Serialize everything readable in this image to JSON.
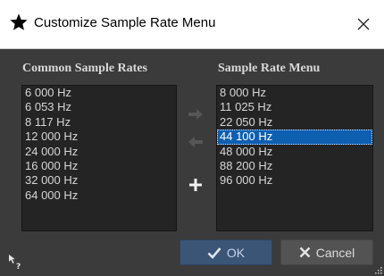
{
  "window": {
    "title": "Customize Sample Rate Menu",
    "title_icon": "star-icon",
    "close_icon": "close-icon"
  },
  "left_panel": {
    "header": "Common Sample Rates",
    "items": [
      "6 000 Hz",
      "6 053 Hz",
      "8 117 Hz",
      "12 000 Hz",
      "24 000 Hz",
      "16 000 Hz",
      "32 000 Hz",
      "64 000 Hz"
    ]
  },
  "right_panel": {
    "header": "Sample Rate Menu",
    "items": [
      "8 000 Hz",
      "11 025 Hz",
      "22 050 Hz",
      "44 100 Hz",
      "48 000 Hz",
      "88 200 Hz",
      "96 000 Hz"
    ],
    "selected_item": "44 100 Hz"
  },
  "controls": {
    "move_right_icon": "arrow-right-icon",
    "move_left_icon": "arrow-left-icon",
    "add_icon": "plus-icon"
  },
  "buttons": {
    "ok_label": "OK",
    "cancel_label": "Cancel",
    "ok_icon": "checkmark-icon",
    "cancel_icon": "x-icon"
  },
  "colors": {
    "selection": "#0f5fb0",
    "ok_button": "#3b5576",
    "background": "#3b3b3b",
    "list_bg": "#242424"
  }
}
